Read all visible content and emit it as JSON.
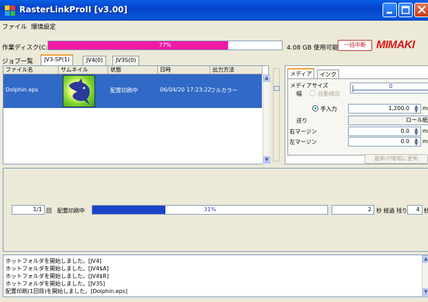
{
  "window": {
    "title": "RasterLinkProII  [v3.00]"
  },
  "menu": [
    {
      "label": "ファイル"
    },
    {
      "label": "環境設定"
    }
  ],
  "disk": {
    "label": "作業ディスク(C:)",
    "percent_text": "77%",
    "fraction": 0.77,
    "used_text": "4.08 GB 使用可能",
    "fill_color": "#f01aa5"
  },
  "toolbar": {
    "cancel_all_label": "一括中断",
    "logo_text": "MIMAKI"
  },
  "tabs": {
    "job_list_label": "ジョブ一覧",
    "items": [
      {
        "label": "JV3-SP(1)"
      },
      {
        "label": "JV4(0)"
      },
      {
        "label": "JV3S(0)"
      }
    ]
  },
  "job_list": {
    "columns": [
      "ファイル名",
      "サムネイル",
      "状態",
      "日時",
      "出力方法"
    ],
    "rows": [
      {
        "file": "Dolphin.eps",
        "status": "配置印刷中",
        "datetime": "06/04/20 17:23:22",
        "output": "フルカラー"
      }
    ]
  },
  "right_panel": {
    "tabs": [
      {
        "label": "メディア"
      },
      {
        "label": "インク"
      }
    ],
    "media_size_label": "メディアサイズ",
    "width_label": "幅",
    "auto_detect_label": "自動検出",
    "manual_label": "手入力",
    "gauge_value": "0",
    "manual_value": "1,200.0",
    "unit": "mm",
    "feed_label": "送り",
    "feed_value": "ロール紙",
    "right_margin_label": "右マージン",
    "right_margin_value": "0.0",
    "left_margin_label": "左マージン",
    "left_margin_value": "0.0",
    "refresh_label": "最新の情報に更新"
  },
  "progress": {
    "copies_text": "1/1",
    "copies_unit": "回",
    "status_text": "配置印刷中",
    "percent_text": "31%",
    "fraction": 0.31,
    "elapsed_value": "2",
    "elapsed_label": "秒 経過  残り 約",
    "remaining_value": "4",
    "remaining_unit": "秒"
  },
  "log": [
    "ホットフォルダを開始しました。[JV4]",
    "ホットフォルダを開始しました。[JV4$A]",
    "ホットフォルダを開始しました。[JV4$R]",
    "ホットフォルダを開始しました。[JV3S]",
    "配置印刷(1回目)を開始しました。[Dolphin.eps]"
  ]
}
